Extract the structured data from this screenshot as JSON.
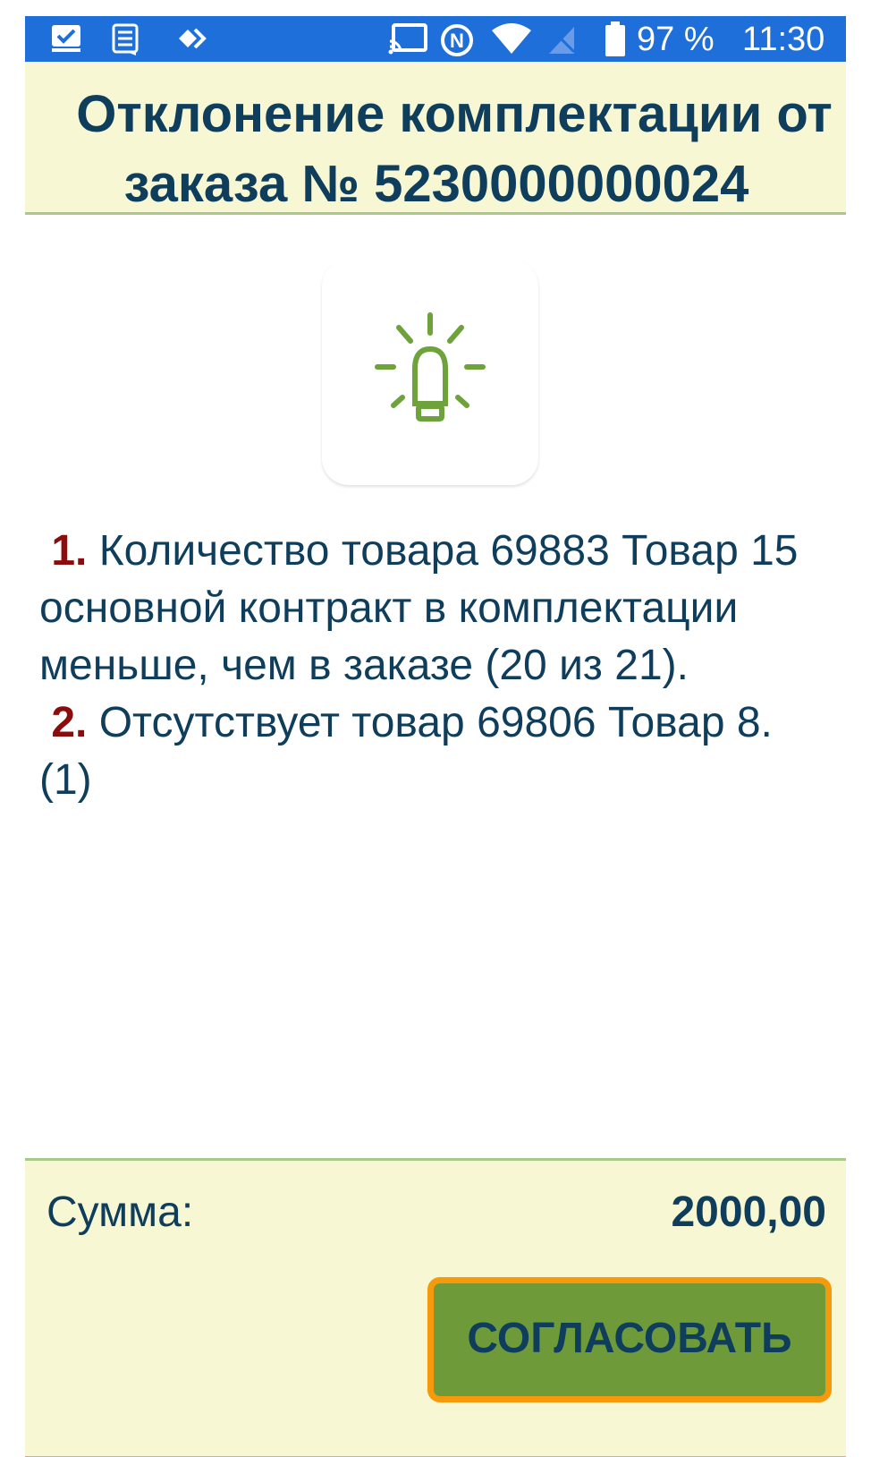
{
  "status_bar": {
    "battery": "97 %",
    "time": "11:30",
    "icons": [
      "checkbox-notification-icon",
      "message-notification-icon",
      "code-notification-icon",
      "cast-icon",
      "nfc-icon",
      "wifi-icon",
      "no-sim-icon",
      "battery-icon"
    ]
  },
  "header": {
    "title_line1": "Отклонение комплектации от",
    "title_line2": "заказа № 5230000000024"
  },
  "content": {
    "icon": "lightbulb-icon",
    "messages": [
      {
        "num": "1.",
        "text": "Количество товара 69883 Товар 15 основной контракт в комплектации меньше, чем в заказе (20 из 21)."
      },
      {
        "num": "2.",
        "text": "Отсутствует товар 69806 Товар 8. (1)"
      }
    ]
  },
  "footer": {
    "sum_label": "Сумма:",
    "sum_value": "2000,00",
    "approve_label": "СОГЛАСОВАТЬ"
  },
  "colors": {
    "status_bar": "#1e6fd9",
    "panel_bg": "#f7f7d4",
    "title_text": "#0f3d5c",
    "number_accent": "#8a0c0c",
    "button_bg": "#6f9a3a",
    "button_border": "#f59a0c",
    "icon_green": "#6ea33b"
  }
}
